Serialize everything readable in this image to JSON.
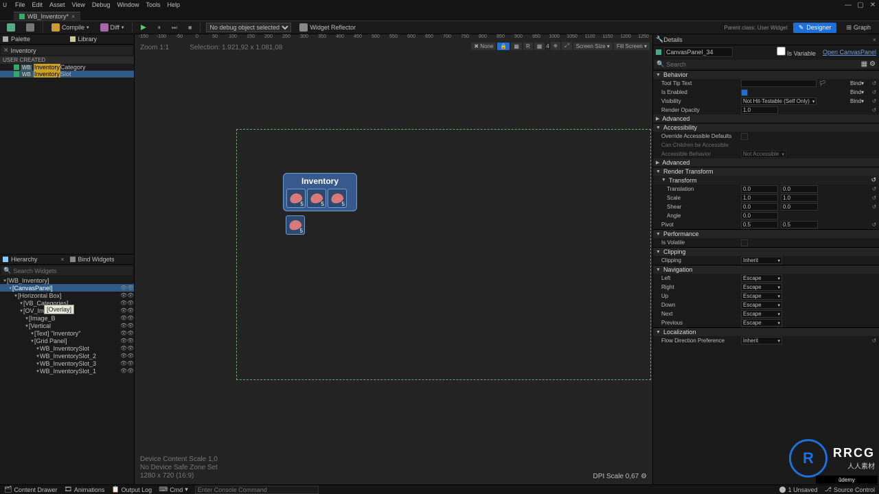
{
  "menubar": [
    "File",
    "Edit",
    "Asset",
    "View",
    "Debug",
    "Window",
    "Tools",
    "Help"
  ],
  "tab": {
    "name": "WB_Inventory*"
  },
  "toolbar": {
    "compile": "Compile",
    "diff": "Diff",
    "noDebug": "No debug object selected",
    "widgetReflector": "Widget Reflector",
    "designer": "Designer",
    "graph": "Graph"
  },
  "parentInfo": "Parent class: User Widget",
  "palette": {
    "title": "Palette",
    "library": "Library",
    "search": "Inventory",
    "userCreated": "USER CREATED",
    "items": [
      {
        "wb": "WB",
        "match": "Inventory",
        "suffix": "Category"
      },
      {
        "wb": "WB",
        "match": "Inventory",
        "suffix": "Slot"
      }
    ]
  },
  "hierarchyPanel": {
    "title": "Hierarchy",
    "bind": "Bind Widgets",
    "searchPlaceholder": "Search Widgets",
    "tooltip": "[Overlay]",
    "tree": [
      {
        "d": 0,
        "t": "[WB_Inventory]"
      },
      {
        "d": 1,
        "t": "[CanvasPanel]",
        "sel": true,
        "eye": true
      },
      {
        "d": 2,
        "t": "[Horizontal Box]",
        "eye": true
      },
      {
        "d": 3,
        "t": "[VB_Categories]",
        "eye": true
      },
      {
        "d": 3,
        "t": "[OV_Inventory]",
        "eye": true
      },
      {
        "d": 4,
        "t": "[Image_B",
        "eye": true
      },
      {
        "d": 4,
        "t": "[Vertical",
        "eye": true
      },
      {
        "d": 5,
        "t": "[Text] \"Inventory\"",
        "eye": true
      },
      {
        "d": 5,
        "t": "[Grid Panel]",
        "eye": true
      },
      {
        "d": 6,
        "t": "WB_InventorySlot",
        "eye": true
      },
      {
        "d": 6,
        "t": "WB_InventorySlot_2",
        "eye": true
      },
      {
        "d": 6,
        "t": "WB_InventorySlot_3",
        "eye": true
      },
      {
        "d": 6,
        "t": "WB_InventorySlot_1",
        "eye": true
      }
    ]
  },
  "viewport": {
    "zoom": "Zoom 1:1",
    "selection": "Selection: 1.921,92 x 1.081,08",
    "rulerTicks": [
      "-150",
      "-100",
      "-50",
      "0",
      "50",
      "100",
      "150",
      "200",
      "250",
      "300",
      "350",
      "400",
      "450",
      "500",
      "550",
      "600",
      "650",
      "700",
      "750",
      "800",
      "850",
      "900",
      "950",
      "1000",
      "1050",
      "1100",
      "1150",
      "1200",
      "1250"
    ],
    "none": "None",
    "grid": "4",
    "screenSize": "Screen Size",
    "fillScreen": "Fill Screen",
    "invTitle": "Inventory",
    "slotCount": "5",
    "deviceScale": "Device Content Scale 1,0",
    "noSafeZone": "No Device Safe Zone Set",
    "res": "1280 x 720 (16:9)",
    "dpi": "DPI Scale 0,67"
  },
  "details": {
    "title": "Details",
    "objName": "CanvasPanel_34",
    "isVariable": "Is Variable",
    "openLink": "Open CanvasPanel",
    "searchPlaceholder": "Search",
    "sections": {
      "behavior": "Behavior",
      "toolTipText": {
        "label": "Tool Tip Text",
        "value": ""
      },
      "isEnabled": {
        "label": "Is Enabled",
        "value": true
      },
      "visibility": {
        "label": "Visibility",
        "value": "Not Hit-Testable (Self Only)"
      },
      "renderOpacity": {
        "label": "Render Opacity",
        "value": "1.0"
      },
      "advanced": "Advanced",
      "accessibility": "Accessibility",
      "overrideAD": {
        "label": "Override Accessible Defaults",
        "value": false
      },
      "canChildren": {
        "label": "Can Children be Accessible"
      },
      "accessibleBehavior": {
        "label": "Accessible Behavior",
        "value": "Not Accessible"
      },
      "renderTransform": "Render Transform",
      "transform": "Transform",
      "translation": {
        "label": "Translation",
        "x": "0.0",
        "y": "0.0"
      },
      "scale": {
        "label": "Scale",
        "x": "1.0",
        "y": "1.0"
      },
      "shear": {
        "label": "Shear",
        "x": "0.0",
        "y": "0.0"
      },
      "angle": {
        "label": "Angle",
        "value": "0.0"
      },
      "pivot": {
        "label": "Pivot",
        "x": "0.5",
        "y": "0.5"
      },
      "performance": "Performance",
      "isVolatile": {
        "label": "Is Volatile"
      },
      "clipping": {
        "label": "Clipping",
        "value": "Inherit"
      },
      "navigation": "Navigation",
      "navItems": [
        {
          "label": "Left",
          "value": "Escape"
        },
        {
          "label": "Right",
          "value": "Escape"
        },
        {
          "label": "Up",
          "value": "Escape"
        },
        {
          "label": "Down",
          "value": "Escape"
        },
        {
          "label": "Next",
          "value": "Escape"
        },
        {
          "label": "Previous",
          "value": "Escape"
        }
      ],
      "localization": "Localization",
      "flowDir": {
        "label": "Flow Direction Preference",
        "value": "Inherit"
      },
      "bind": "Bind"
    }
  },
  "statusbar": {
    "contentDrawer": "Content Drawer",
    "animations": "Animations",
    "outputLog": "Output Log",
    "cmd": "Cmd",
    "cmdPlaceholder": "Enter Console Command",
    "unsaved": "1 Unsaved",
    "sourceControl": "Source Control"
  },
  "watermark": {
    "main": "RRCG",
    "sub": "人人素材"
  },
  "udemy": "ûdemy"
}
